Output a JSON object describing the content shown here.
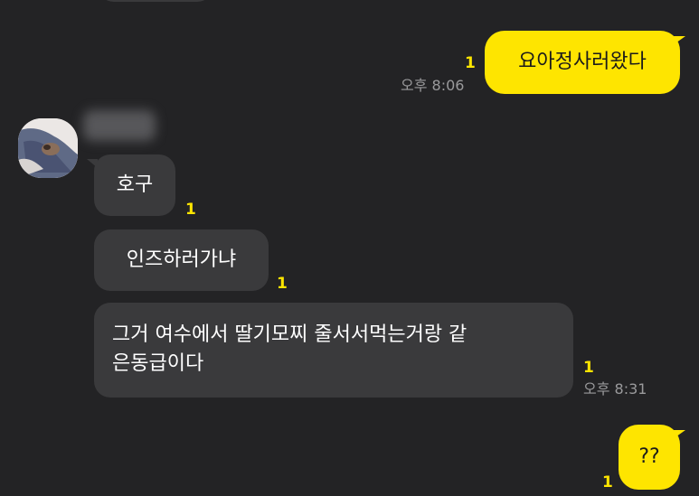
{
  "chat": {
    "messages": [
      {
        "id": "m1",
        "direction": "outgoing",
        "text": "요아정사러왔다",
        "unread": "1",
        "time": "오후 8:06"
      },
      {
        "id": "m2",
        "direction": "incoming",
        "text": "호구",
        "unread": "1"
      },
      {
        "id": "m3",
        "direction": "incoming",
        "text": "인즈하러가냐",
        "unread": "1"
      },
      {
        "id": "m4",
        "direction": "incoming",
        "text_line1": "그거 여수에서 딸기모찌 줄서서먹는거랑 같",
        "text_line2": "은동급이다",
        "unread": "1",
        "time": "오후 8:31"
      },
      {
        "id": "m5",
        "direction": "outgoing",
        "text": "??",
        "unread": "1"
      }
    ],
    "sender": {
      "avatar": "profile-avatar",
      "name_blurred": true
    }
  },
  "colors": {
    "background": "#232325",
    "outgoing_bubble": "#fee500",
    "incoming_bubble": "#3a3a3c",
    "unread_count": "#fee500",
    "timestamp": "#9a9a9c"
  }
}
